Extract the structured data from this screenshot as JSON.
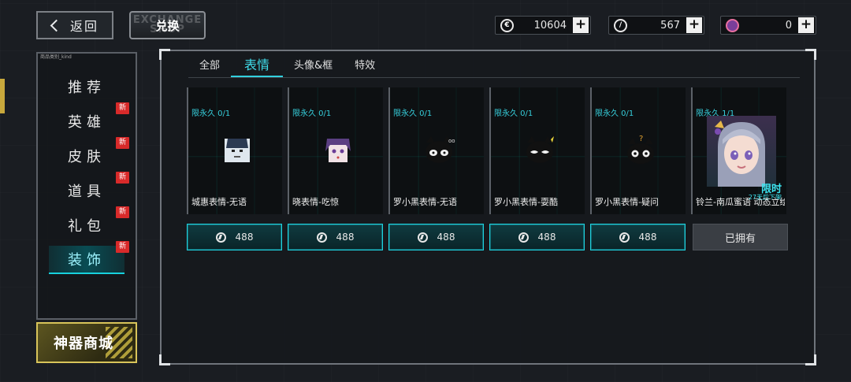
{
  "header": {
    "back_label": "返回",
    "exchange_logo_ghost": "EXCHANGE SHOP",
    "exchange_logo_label": "兑换"
  },
  "currencies": [
    {
      "icon": "credit-coin-icon",
      "amount": "10604"
    },
    {
      "icon": "feather-coin-icon",
      "amount": "567"
    },
    {
      "icon": "gem-icon",
      "amount": "0"
    }
  ],
  "sidebar": {
    "caption": "商品类别_kind",
    "items": [
      {
        "label": "推荐",
        "new": false,
        "active": false
      },
      {
        "label": "英雄",
        "new": true,
        "active": false
      },
      {
        "label": "皮肤",
        "new": true,
        "active": false
      },
      {
        "label": "道具",
        "new": true,
        "active": false
      },
      {
        "label": "礼包",
        "new": true,
        "active": false
      },
      {
        "label": "装饰",
        "new": true,
        "active": true
      }
    ],
    "new_badge": "新",
    "artifact_shop_label": "神器商城"
  },
  "tabs": [
    {
      "label": "全部",
      "active": false
    },
    {
      "label": "表情",
      "active": true
    },
    {
      "label": "头像&框",
      "active": false
    },
    {
      "label": "特效",
      "active": false
    }
  ],
  "products": [
    {
      "limit": "限永久 0/1",
      "name": "城惠表情-无语",
      "price": "488",
      "owned": false
    },
    {
      "limit": "限永久 0/1",
      "name": "晓表情-吃惊",
      "price": "488",
      "owned": false
    },
    {
      "limit": "限永久 0/1",
      "name": "罗小黑表情-无语",
      "price": "488",
      "owned": false
    },
    {
      "limit": "限永久 0/1",
      "name": "罗小黑表情-耍酷",
      "price": "488",
      "owned": false
    },
    {
      "limit": "限永久 0/1",
      "name": "罗小黑表情-疑问",
      "price": "488",
      "owned": false
    },
    {
      "limit": "限永久 1/1",
      "name": "铃兰-南瓜蜜语 动态立绘",
      "price": "",
      "owned": true,
      "limited_label": "限时",
      "days_label": "27天后下架",
      "owned_label": "已拥有"
    }
  ],
  "colors": {
    "accent": "#32d0de",
    "new_badge": "#d82a2a",
    "artifact_gold": "#d8c45a"
  }
}
